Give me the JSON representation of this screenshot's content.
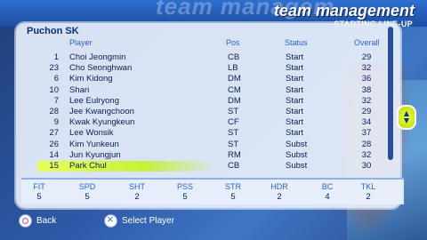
{
  "header": {
    "watermark": "team managem",
    "title": "team management",
    "subtitle": "STARTING LINE-UP"
  },
  "team": {
    "name": "Puchon SK"
  },
  "columns": {
    "player": "Player",
    "pos": "Pos",
    "status": "Status",
    "overall": "Overall"
  },
  "players": [
    {
      "num": "1",
      "name": "Choi Jeongmin",
      "pos": "CB",
      "status": "Start",
      "overall": "29"
    },
    {
      "num": "23",
      "name": "Cho Seonghwan",
      "pos": "LB",
      "status": "Start",
      "overall": "32"
    },
    {
      "num": "6",
      "name": "Kim Kidong",
      "pos": "DM",
      "status": "Start",
      "overall": "36"
    },
    {
      "num": "10",
      "name": "Shari",
      "pos": "CM",
      "status": "Start",
      "overall": "38"
    },
    {
      "num": "7",
      "name": "Lee Eulryong",
      "pos": "DM",
      "status": "Start",
      "overall": "32"
    },
    {
      "num": "28",
      "name": "Jee Kwangchoon",
      "pos": "ST",
      "status": "Start",
      "overall": "29"
    },
    {
      "num": "9",
      "name": "Kwak Kyungkeun",
      "pos": "CF",
      "status": "Start",
      "overall": "34"
    },
    {
      "num": "27",
      "name": "Lee Wonsik",
      "pos": "ST",
      "status": "Start",
      "overall": "37"
    },
    {
      "num": "26",
      "name": "Kim Yunkeun",
      "pos": "ST",
      "status": "Subst",
      "overall": "28"
    },
    {
      "num": "14",
      "name": "Jun Kyungjun",
      "pos": "RM",
      "status": "Subst",
      "overall": "32"
    },
    {
      "num": "15",
      "name": "Park Chul",
      "pos": "CB",
      "status": "Subst",
      "overall": "30"
    }
  ],
  "selected_index": 10,
  "stats": [
    {
      "label": "FIT",
      "value": "5"
    },
    {
      "label": "SPD",
      "value": "5"
    },
    {
      "label": "SHT",
      "value": "2"
    },
    {
      "label": "PSS",
      "value": "5"
    },
    {
      "label": "STR",
      "value": "5"
    },
    {
      "label": "HDR",
      "value": "2"
    },
    {
      "label": "BC",
      "value": "4"
    },
    {
      "label": "TKL",
      "value": "2"
    }
  ],
  "footer": {
    "back_label": "Back",
    "back_icon": "circle-button-icon",
    "select_label": "Select Player",
    "select_icon": "cross-button-icon"
  }
}
